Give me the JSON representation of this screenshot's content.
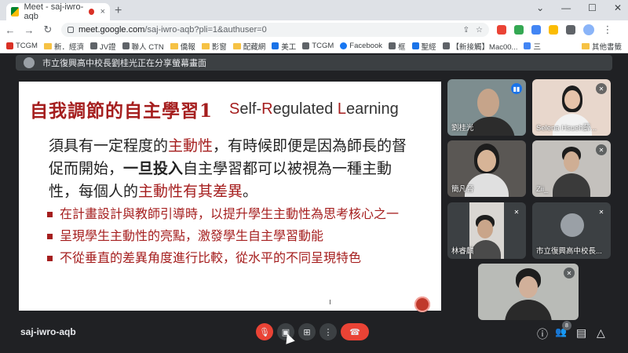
{
  "browser": {
    "tab_title": "Meet - saj-iwro-aqb",
    "tab_close": "×",
    "new_tab": "+",
    "window_controls": [
      "⌄",
      "—",
      "☐",
      "✕"
    ],
    "nav_back": "←",
    "nav_forward": "→",
    "nav_reload": "↻",
    "url_host": "meet.google.com",
    "url_path": "/saj-iwro-aqb?pli=1&authuser=0",
    "menu": "⋮",
    "bookmarks": [
      "TCGM",
      "新．經濟",
      "JV證",
      "聯人 CTN",
      "僑報",
      "影窗",
      "配藏網",
      "美工",
      "TCGM",
      "Facebook",
      "框",
      "聖經",
      "【新接觸】Mac00...",
      "三",
      "其他書籤"
    ]
  },
  "meet": {
    "presenting_text": "市立復興高中校長劉桂光正在分享螢幕畫面",
    "meeting_code": "saj-iwro-aqb",
    "participant_count": "8"
  },
  "slide": {
    "title_zh": "自我調節的自主學習1",
    "title_en": {
      "s": "S",
      "s_rest": "elf-",
      "r": "R",
      "r_rest": "egulated ",
      "l": "L",
      "l_rest": "earning"
    },
    "para": {
      "p1": "須具有一定程度的",
      "p2": "主動性",
      "p3": "，有時候即便是因為師長的督促而開始，",
      "p4": "一旦投入",
      "p5": "自主學習都可以被視為一種主動性，每個人的",
      "p6": "主動性有其差異",
      "p7": "。"
    },
    "bullets": [
      "在計畫設計與教師引導時，以提升學生主動性為思考核心之一",
      "呈現學生主動性的亮點，激發學生自主學習動能",
      "不從垂直的差異角度進行比較，從水平的不同呈現特色"
    ]
  },
  "participants": [
    {
      "name": "劉桂光",
      "speaking": true
    },
    {
      "name": "Selena Hsueh薛...",
      "speaking": false
    },
    {
      "name": "簡凡晉",
      "speaking": false
    },
    {
      "name": "Zii_",
      "speaking": false
    },
    {
      "name": "林睿麒",
      "speaking": false
    },
    {
      "name": "市立復興高中校長...",
      "speaking": false
    },
    {
      "name": "",
      "speaking": false
    }
  ],
  "icons": {
    "mic_off": "🎙",
    "mic_muted_glyph": "✕",
    "speaking_glyph": "▮▮",
    "camera": "▣",
    "present": "⊞",
    "more": "⋮",
    "hangup": "☎",
    "info": "ⓘ",
    "people": "👥",
    "chat": "▤",
    "activities": "△"
  }
}
